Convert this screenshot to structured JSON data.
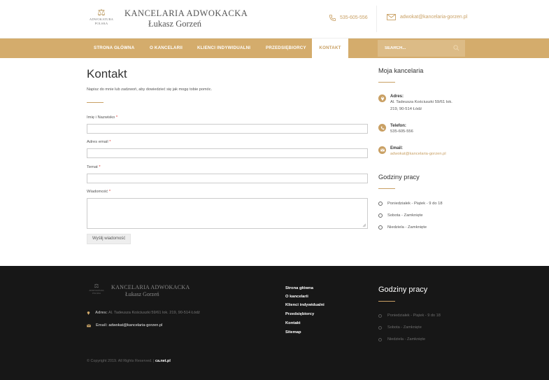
{
  "header": {
    "logo_line1": "ADWOKATURA",
    "logo_line2": "POLSKA",
    "title": "KANCELARIA ADWOKACKA",
    "name": "Łukasz Gorzeń",
    "phone": "535-605-556",
    "email": "adwokat@kancelaria-gorzen.pl",
    "icons": {
      "phone": "phone-icon",
      "email": "envelope-icon"
    }
  },
  "nav": {
    "items": [
      "STRONA GŁÓWNA",
      "O KANCELARII",
      "KLIENCI INDYWIDUALNI",
      "PRZEDSIĘBIORCY",
      "KONTAKT"
    ],
    "active": "KONTAKT",
    "search_placeholder": "SEARCH..."
  },
  "main": {
    "title": "Kontakt",
    "intro": "Napisz do mnie lub zadzwoń, aby dowiedzieć się jak mogę tobie pomóc.",
    "fields": [
      {
        "label": "Imię i Nazwisko",
        "value": ""
      },
      {
        "label": "Adres email",
        "value": ""
      },
      {
        "label": "Temat",
        "value": ""
      }
    ],
    "message_label": "Wiadomość",
    "message_value": "",
    "required_mark": "*",
    "send_label": "Wyślij wiadomość"
  },
  "sidebar": {
    "title": "Moja kancelaria",
    "address_label": "Adres:",
    "address_line1": "Al. Tadeusza Kościuszki 59/61 lok.",
    "address_line2": "219, 90-514 Łódź",
    "phone_label": "Telefon:",
    "phone": "535-605-556",
    "email_label": "Email:",
    "email": "adwokat@kancelaria-gorzen.pl",
    "hours_title": "Godziny pracy",
    "hours": [
      "Poniedziałek - Piątek - 9 do 18",
      "Sobota - Zamknięte",
      "Niedziela - Zamknięte"
    ]
  },
  "footer": {
    "logo_line1": "ADWOKATURA",
    "logo_line2": "POLSKA",
    "title": "KANCELARIA ADWOKACKA",
    "name": "Łukasz Gorzeń",
    "address_label": "Adres:",
    "address": "Al. Tadeusza Kościuszki 59/61 lok. 219, 90-514 Łódź",
    "email_label": "Email:",
    "email": "adwokat@kancelaria-gorzen.pl",
    "links": [
      "Strona główna",
      "O kancelarii",
      "Klienci indywidualni",
      "Przedsiębiorcy",
      "Kontakt",
      "Sitemap"
    ],
    "hours_title": "Godziny pracy",
    "hours": [
      "Poniedziałek - Piątek - 9 do 18",
      "Sobota - Zamknięte",
      "Niedziela - Zamknięte"
    ],
    "copyright": "© Copyright 2019. All Rights Reserved.  |",
    "credit": "ca.net.pl"
  },
  "colors": {
    "gold": "#d4ac6c",
    "footer_bg": "#171717",
    "required": "#e53935"
  }
}
